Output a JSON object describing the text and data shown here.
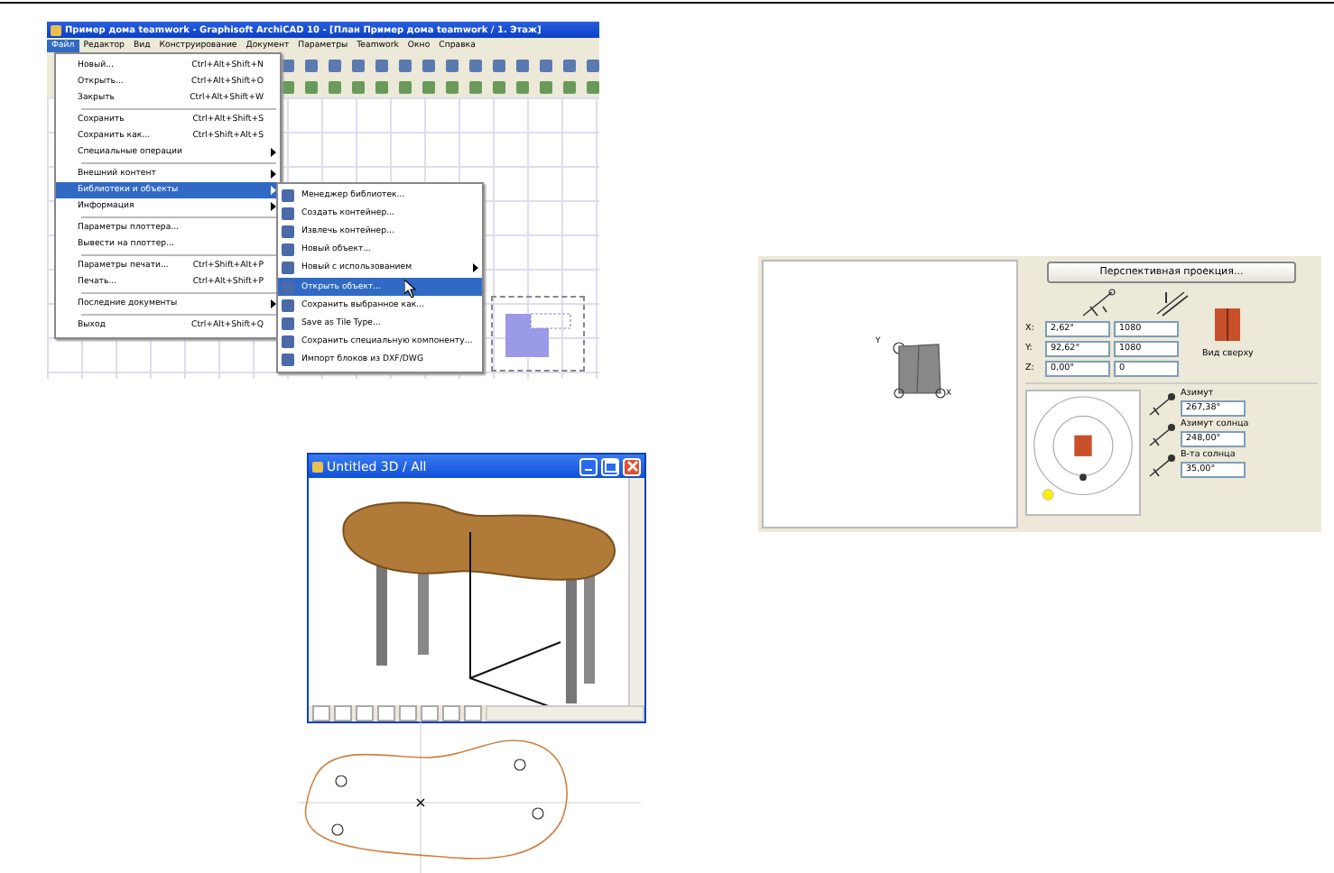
{
  "main_window": {
    "title": "Пример дома teamwork - Graphisoft ArchiCAD 10 - [План Пример дома teamwork / 1. Этаж]",
    "menu": [
      {
        "label": "Файл",
        "selected": true
      },
      {
        "label": "Редактор",
        "selected": false
      },
      {
        "label": "Вид",
        "selected": false
      },
      {
        "label": "Конструирование",
        "selected": false
      },
      {
        "label": "Документ",
        "selected": false
      },
      {
        "label": "Параметры",
        "selected": false
      },
      {
        "label": "Teamwork",
        "selected": false
      },
      {
        "label": "Окно",
        "selected": false
      },
      {
        "label": "Справка",
        "selected": false
      }
    ]
  },
  "file_menu": [
    {
      "kind": "item",
      "label": "Новый...",
      "shortcut": "Ctrl+Alt+Shift+N",
      "selected": false,
      "submenu": false
    },
    {
      "kind": "item",
      "label": "Открыть...",
      "shortcut": "Ctrl+Alt+Shift+O",
      "selected": false,
      "submenu": false
    },
    {
      "kind": "item",
      "label": "Закрыть",
      "shortcut": "Ctrl+Alt+Shift+W",
      "selected": false,
      "submenu": false
    },
    {
      "kind": "separator"
    },
    {
      "kind": "item",
      "label": "Сохранить",
      "shortcut": "Ctrl+Alt+Shift+S",
      "selected": false,
      "submenu": false
    },
    {
      "kind": "item",
      "label": "Сохранить как...",
      "shortcut": "Ctrl+Shift+Alt+S",
      "selected": false,
      "submenu": false
    },
    {
      "kind": "item",
      "label": "Специальные операции",
      "selected": false,
      "submenu": true
    },
    {
      "kind": "separator"
    },
    {
      "kind": "item",
      "label": "Внешний контент",
      "selected": false,
      "submenu": true
    },
    {
      "kind": "item",
      "label": "Библиотеки и объекты",
      "selected": true,
      "submenu": true
    },
    {
      "kind": "item",
      "label": "Информация",
      "selected": false,
      "submenu": true
    },
    {
      "kind": "separator"
    },
    {
      "kind": "item",
      "label": "Параметры плоттера...",
      "selected": false,
      "submenu": false
    },
    {
      "kind": "item",
      "label": "Вывести на плоттер...",
      "selected": false,
      "submenu": false
    },
    {
      "kind": "separator"
    },
    {
      "kind": "item",
      "label": "Параметры печати...",
      "shortcut": "Ctrl+Shift+Alt+P",
      "selected": false,
      "submenu": false
    },
    {
      "kind": "item",
      "label": "Печать...",
      "shortcut": "Ctrl+Alt+Shift+P",
      "selected": false,
      "submenu": false
    },
    {
      "kind": "separator"
    },
    {
      "kind": "item",
      "label": "Последние документы",
      "selected": false,
      "submenu": true
    },
    {
      "kind": "separator"
    },
    {
      "kind": "item",
      "label": "Выход",
      "shortcut": "Ctrl+Alt+Shift+Q",
      "selected": false,
      "submenu": false
    }
  ],
  "library_submenu": [
    {
      "label": "Менеджер библиотек...",
      "selected": false,
      "submenu": false
    },
    {
      "label": "Создать контейнер...",
      "selected": false,
      "submenu": false
    },
    {
      "label": "Извлечь контейнер...",
      "selected": false,
      "submenu": false
    },
    {
      "label": "Новый объект...",
      "selected": false,
      "submenu": false
    },
    {
      "label": "Новый с использованием",
      "selected": false,
      "submenu": true
    },
    {
      "label": "Открыть объект...",
      "selected": true,
      "submenu": false
    },
    {
      "label": "Сохранить выбранное как...",
      "selected": false,
      "submenu": false
    },
    {
      "label": "Save as Tile Type...",
      "selected": false,
      "submenu": false
    },
    {
      "label": "Сохранить специальную компоненту...",
      "selected": false,
      "submenu": false
    },
    {
      "label": "Импорт блоков из DXF/DWG",
      "selected": false,
      "submenu": false
    }
  ],
  "view_3d_window": {
    "title": "Untitled 3D / All"
  },
  "view_settings": {
    "button": "Перспективная проекция...",
    "preview": {
      "y_label": "Y",
      "x_label": "X"
    },
    "coords": [
      {
        "axis": "X:",
        "angle": "2,62°",
        "distance": "1080"
      },
      {
        "axis": "Y:",
        "angle": "92,62°",
        "distance": "1080"
      },
      {
        "axis": "Z:",
        "angle": "0,00°",
        "distance": "0"
      }
    ],
    "view_label": "Вид сверху",
    "sun": [
      {
        "label": "Азимут",
        "value": "267,38°"
      },
      {
        "label": "Азимут солнца",
        "value": "248,00°"
      },
      {
        "label": "В-та солнца",
        "value": "35,00°"
      }
    ]
  }
}
